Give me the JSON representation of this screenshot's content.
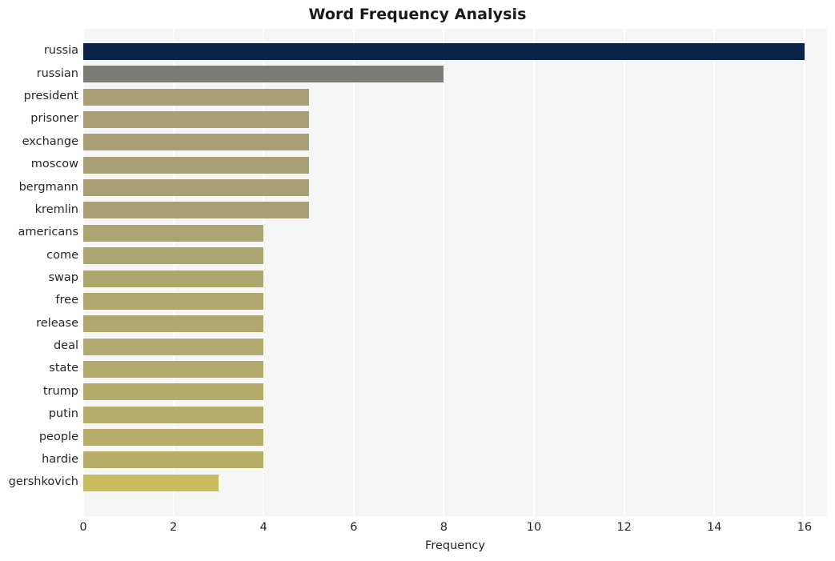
{
  "chart_data": {
    "type": "bar",
    "orientation": "horizontal",
    "title": "Word Frequency Analysis",
    "xlabel": "Frequency",
    "ylabel": "",
    "xlim": [
      0,
      16.5
    ],
    "xticks": [
      0,
      2,
      4,
      6,
      8,
      10,
      12,
      14,
      16
    ],
    "xtick_labels": [
      "0",
      "2",
      "4",
      "6",
      "8",
      "10",
      "12",
      "14",
      "16"
    ],
    "grid": "vertical",
    "legend": "none",
    "background_color": "#f6f6f7",
    "gridline_color": "#ffffff",
    "categories": [
      "russia",
      "russian",
      "president",
      "prisoner",
      "exchange",
      "moscow",
      "bergmann",
      "kremlin",
      "americans",
      "come",
      "swap",
      "free",
      "release",
      "deal",
      "state",
      "trump",
      "putin",
      "people",
      "hardie",
      "gershkovich"
    ],
    "values": [
      16,
      8,
      5,
      5,
      5,
      5,
      5,
      5,
      4,
      4,
      4,
      4,
      4,
      4,
      4,
      4,
      4,
      4,
      4,
      3
    ],
    "bar_colors": [
      "#0a2449",
      "#7c7b76",
      "#a89f74",
      "#a89f74",
      "#a89f74",
      "#a89f74",
      "#a89f74",
      "#a89f74",
      "#aca471",
      "#ada570",
      "#aea66f",
      "#afa76f",
      "#b0a86e",
      "#b1a96d",
      "#b2aa6c",
      "#b3ab6b",
      "#b4ac6a",
      "#b5ad69",
      "#b6ae68",
      "#c9bc5e"
    ]
  }
}
